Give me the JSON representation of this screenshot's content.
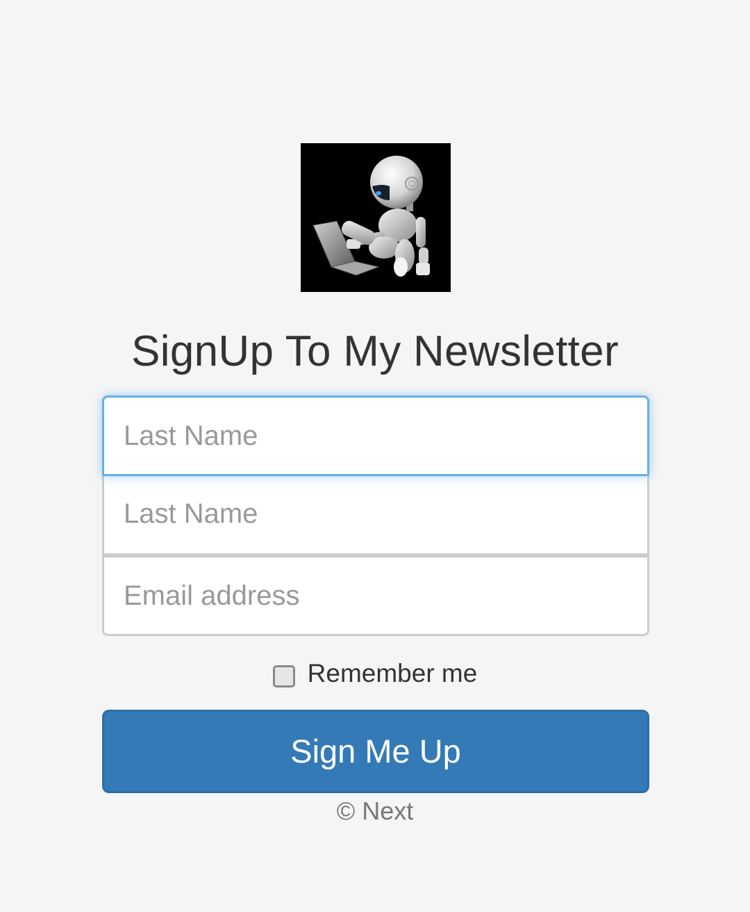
{
  "logo": {
    "icon": "robot-with-laptop-icon"
  },
  "heading": "SignUp To My Newsletter",
  "form": {
    "first_name": {
      "placeholder": "Last Name",
      "value": ""
    },
    "last_name": {
      "placeholder": "Last Name",
      "value": ""
    },
    "email": {
      "placeholder": "Email address",
      "value": ""
    },
    "remember_label": "Remember me",
    "remember_checked": false,
    "submit_label": "Sign Me Up"
  },
  "footer": "© Next",
  "colors": {
    "background": "#f5f5f5",
    "primary": "#337ab7",
    "focus": "#66afe9",
    "text": "#333333"
  }
}
